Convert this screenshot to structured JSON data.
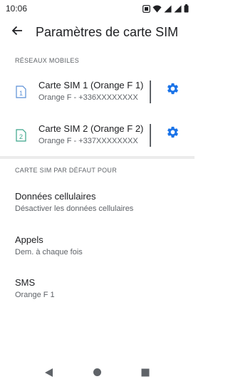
{
  "status_bar": {
    "time": "10:06"
  },
  "app_bar": {
    "title": "Paramètres de carte SIM"
  },
  "sections": {
    "mobile_networks": "RÉSEAUX MOBILES",
    "default_sim": "CARTE SIM PAR DÉFAUT POUR"
  },
  "sims": [
    {
      "slot": "1",
      "title": "Carte SIM 1 (Orange F 1)",
      "subtitle": "Orange F - +336XXXXXXXX",
      "icon_color": "#5b8fd6"
    },
    {
      "slot": "2",
      "title": "Carte SIM 2 (Orange F 2)",
      "subtitle": "Orange F - +337XXXXXXXX",
      "icon_color": "#3aa58a"
    }
  ],
  "preferences": [
    {
      "title": "Données cellulaires",
      "subtitle": "Désactiver les données cellulaires"
    },
    {
      "title": "Appels",
      "subtitle": "Dem. à chaque fois"
    },
    {
      "title": "SMS",
      "subtitle": "Orange F 1"
    }
  ],
  "colors": {
    "accent": "#1a73e8",
    "text_primary": "#202124",
    "text_secondary": "#5f6368"
  },
  "icons": {
    "back": "arrow-back-icon",
    "settings": "gear-icon",
    "nav_back": "triangle-back-icon",
    "nav_home": "circle-home-icon",
    "nav_recents": "square-recents-icon"
  }
}
